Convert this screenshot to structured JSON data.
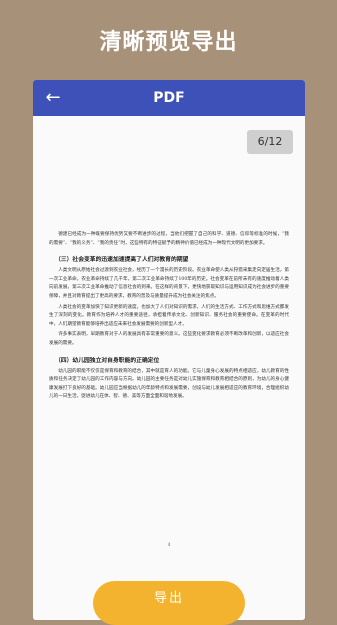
{
  "promo": {
    "title": "清晰预览导出"
  },
  "app": {
    "title": "PDF",
    "back_icon": "arrow-left-icon"
  },
  "viewer": {
    "page_indicator": "6/12"
  },
  "document": {
    "intro_lines": [
      "德建已经成为一种既要保持优势又要不断进步的过程，当他们把握了自己的科学、道德、信仰等标准的时候，“我的需要”、“我的义务”、“我的责任”时，这些特有的特征赋予的精神价值已经成为一种现代文明的更加要求。"
    ],
    "sections": [
      {
        "heading": "（三）社会变革的迅速加速提高了人们对教育的期望",
        "paragraphs": [
          "人类文明从原始社会过渡到农业社会，经历了一个漫长的历史阶段。农业革命使人类从狩猎采集走向定居生活，第一次工业革命，农业革命持续了几千年，第二次工业革命持续了100年的历史。社会变革在前所未有的速度推动着人类向前发展，第三次工业革命推动了信息社会的到来。在这样的背景下，更快地获取知识与运用知识成为社会进步的重要保障，并且对教育提出了更高的要求，教育的普及与质量提升成为社会关注的焦点。",
          "人类社会的变革加快了知识更新的速度，也加大了人们对知识的需求，人们的生活方式、工作方式和思维方式都发生了深刻的变化。教育作为培养人才的重要途径，承担着传承文化、创新知识、服务社会的重要使命。在变革的时代中，人们期望教育能够培养出适应未来社会发展需要的创新型人才。",
          "许多事实表明，早期教育对于人的发展具有非常重要的意义。这些变化要求教育必须不断改革和创新，以适应社会发展的需要。"
        ]
      },
      {
        "heading": "（四）幼儿园独立对自身职能的正确定位",
        "paragraphs": [
          "幼儿园的职能不仅仅是保育和教育的结合，其中就是育人的功能。它与儿童身心发展的特点相适应，幼儿教育的性质和任务决定了幼儿园的工作内容与方向。幼儿园的主要任务是对幼儿实施保育和教育相结合的原则，为幼儿的身心健康发展打下良好的基础。幼儿园应当根据幼儿的年龄特点和发展需要，创设与幼儿发展相适应的教育环境，合理组织幼儿的一日生活，促进幼儿在体、智、德、美等方面全面和谐地发展。"
        ]
      }
    ],
    "page_number": "4"
  },
  "export": {
    "label": "导出"
  }
}
